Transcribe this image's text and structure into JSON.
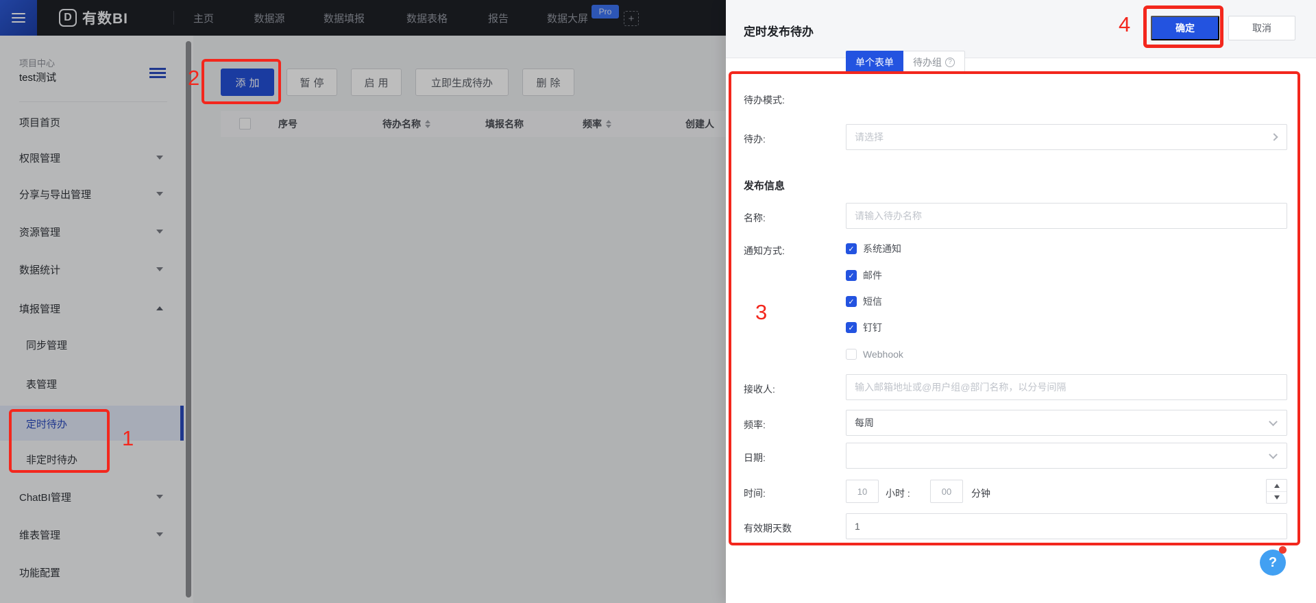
{
  "colors": {
    "accent": "#2353e0",
    "annotation_red": "#f3271d",
    "help_blue": "#42a0f2",
    "nav_bg": "#1e2127",
    "selected_blue": "#2b4bbf"
  },
  "topnav": {
    "logo_text": "有数BI",
    "logo_glyph": "D",
    "items": [
      "主页",
      "数据源",
      "数据填报",
      "数据表格",
      "报告",
      "数据大屏"
    ],
    "pro_badge": "Pro",
    "plus_icon": "+"
  },
  "sidebar": {
    "project_label": "项目中心",
    "project_name": "test测试",
    "items": [
      {
        "label": "项目首页"
      },
      {
        "label": "权限管理"
      },
      {
        "label": "分享与导出管理"
      },
      {
        "label": "资源管理"
      },
      {
        "label": "数据统计"
      },
      {
        "label": "填报管理"
      },
      {
        "label": "同步管理"
      },
      {
        "label": "表管理"
      },
      {
        "label": "定时待办"
      },
      {
        "label": "非定时待办"
      },
      {
        "label": "ChatBI管理"
      },
      {
        "label": "维表管理"
      },
      {
        "label": "功能配置"
      }
    ]
  },
  "main": {
    "toolbar": {
      "add": "添加",
      "pause": "暂停",
      "enable": "启用",
      "generate": "立即生成待办",
      "delete": "删除"
    },
    "table": {
      "columns": [
        {
          "label": "序号"
        },
        {
          "label": "待办名称"
        },
        {
          "label": "填报名称"
        },
        {
          "label": "频率"
        },
        {
          "label": "创建人"
        }
      ]
    }
  },
  "drawer": {
    "title": "定时发布待办",
    "ok_label": "确定",
    "cancel_label": "取消",
    "form": {
      "mode_label": "待办模式:",
      "mode_single": "单个表单",
      "mode_group": "待办组",
      "mode_group_help": "?",
      "todo_label": "待办:",
      "todo_placeholder": "请选择",
      "section_publish": "发布信息",
      "name_label": "名称:",
      "name_placeholder": "请输入待办名称",
      "notify_label": "通知方式:",
      "notify_options": [
        {
          "label": "系统通知",
          "checked": true
        },
        {
          "label": "邮件",
          "checked": true
        },
        {
          "label": "短信",
          "checked": true
        },
        {
          "label": "钉钉",
          "checked": true
        },
        {
          "label": "Webhook",
          "checked": false
        }
      ],
      "check_glyph": "✓",
      "receiver_label": "接收人:",
      "receiver_placeholder": "输入邮箱地址或@用户组@部门名称，以分号间隔",
      "freq_label": "频率:",
      "freq_value": "每周",
      "date_label": "日期:",
      "time_label": "时间:",
      "hour_value": "10",
      "hour_unit": "小时 :",
      "minute_value": "00",
      "minute_unit": "分钟",
      "validity_label": "有效期天数",
      "validity_value": "1"
    }
  },
  "annotations": {
    "n1": "1",
    "n2": "2",
    "n3": "3",
    "n4": "4"
  },
  "help": {
    "glyph": "?"
  }
}
